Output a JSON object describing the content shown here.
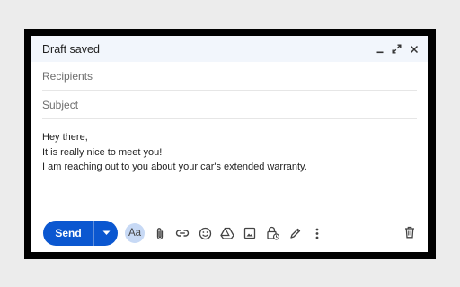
{
  "compose": {
    "title": "Draft saved",
    "recipients_placeholder": "Recipients",
    "subject_placeholder": "Subject",
    "body_lines": [
      "Hey there,",
      "It is really nice to meet you!",
      "I am reaching out to you about your car's extended warranty."
    ]
  },
  "window_controls": {
    "icons": [
      "minimize-icon",
      "expand-icon",
      "close-icon"
    ]
  },
  "toolbar": {
    "send_label": "Send",
    "format_label": "Aa",
    "icons": [
      "more-send-options-icon",
      "formatting-options-icon",
      "attach-icon",
      "link-icon",
      "emoji-icon",
      "drive-icon",
      "photo-icon",
      "confidential-mode-icon",
      "signature-icon",
      "more-options-icon",
      "discard-draft-icon"
    ]
  },
  "colors": {
    "send_button": "#0b57d0",
    "titlebar_bg": "#f2f6fc",
    "format_button_bg": "#c7d9f5",
    "frame": "#000000",
    "page_bg": "#ececec"
  }
}
